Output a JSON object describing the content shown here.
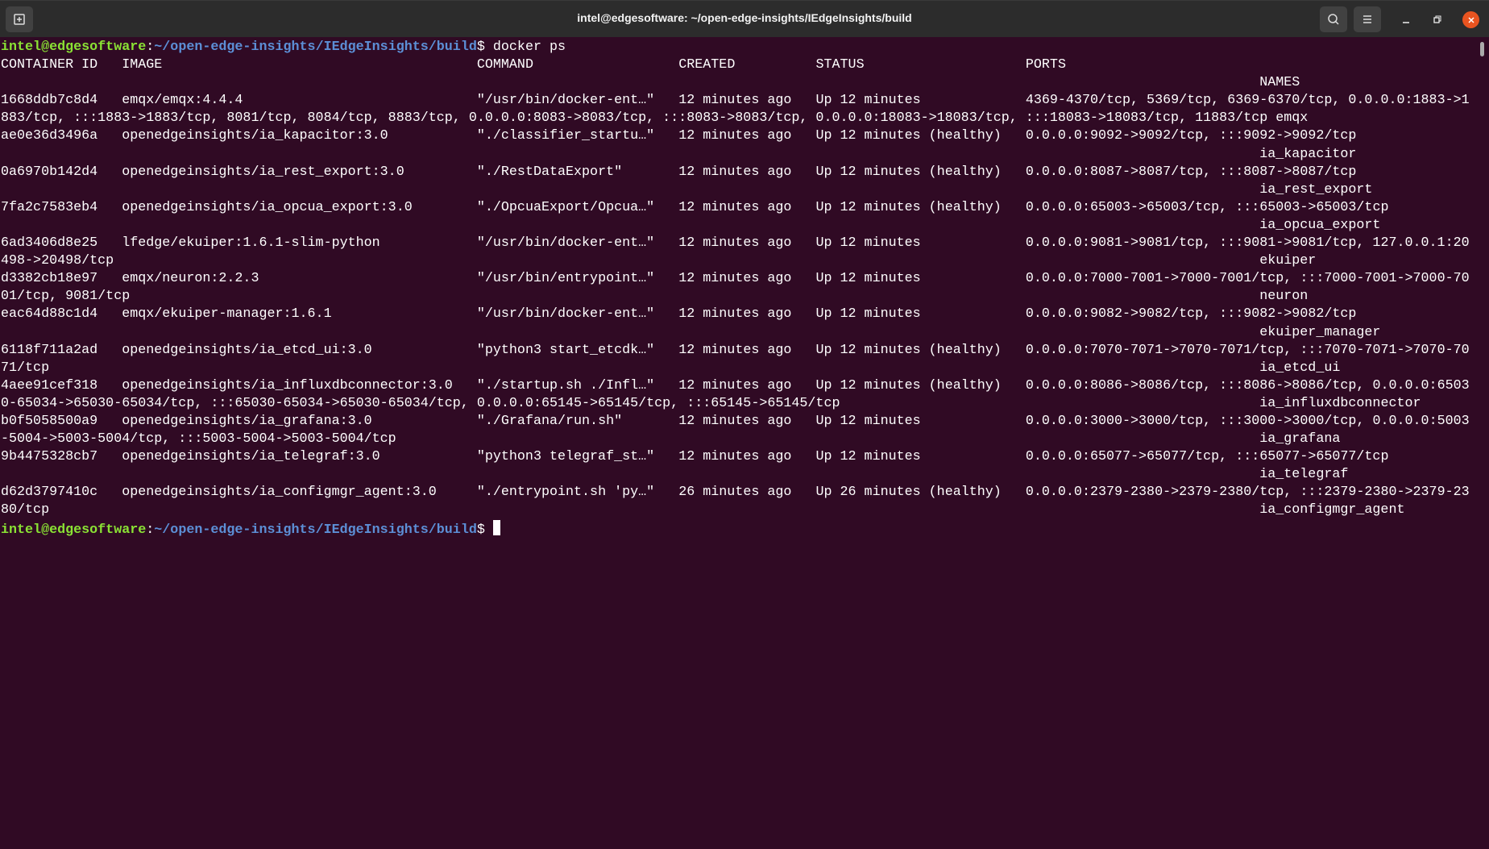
{
  "window": {
    "title": "intel@edgesoftware: ~/open-edge-insights/IEdgeInsights/build",
    "icons": [
      "new-tab-icon",
      "search-icon",
      "hamburger-menu-icon",
      "minimize-icon",
      "maximize-icon",
      "close-icon"
    ]
  },
  "colors": {
    "background": "#300a24",
    "prompt_user": "#8ae234",
    "prompt_path": "#5c8fd6",
    "close": "#e95420"
  },
  "prompt": {
    "user_host": "intel@edgesoftware",
    "sep": ":",
    "path": "~/open-edge-insights/IEdgeInsights/build",
    "symbol": "$ "
  },
  "command": "docker ps",
  "table": {
    "headers": [
      "CONTAINER ID",
      "IMAGE",
      "COMMAND",
      "CREATED",
      "STATUS",
      "PORTS",
      "NAMES"
    ],
    "rows": [
      [
        "1668ddb7c8d4",
        "emqx/emqx:4.4.4",
        "\"/usr/bin/docker-ent…\"",
        "12 minutes ago",
        "Up 12 minutes",
        "4369-4370/tcp, 5369/tcp, 6369-6370/tcp, 0.0.0.0:1883->1883/tcp, :::1883->1883/tcp, 8081/tcp, 8084/tcp, 8883/tcp, 0.0.0.0:8083->8083/tcp, :::8083->8083/tcp, 0.0.0.0:18083->18083/tcp, :::18083->18083/tcp, 11883/tcp",
        "emqx"
      ],
      [
        "ae0e36d3496a",
        "openedgeinsights/ia_kapacitor:3.0",
        "\"./classifier_startu…\"",
        "12 minutes ago",
        "Up 12 minutes (healthy)",
        "0.0.0.0:9092->9092/tcp, :::9092->9092/tcp",
        "ia_kapacitor"
      ],
      [
        "0a6970b142d4",
        "openedgeinsights/ia_rest_export:3.0",
        "\"./RestDataExport\"",
        "12 minutes ago",
        "Up 12 minutes (healthy)",
        "0.0.0.0:8087->8087/tcp, :::8087->8087/tcp",
        "ia_rest_export"
      ],
      [
        "7fa2c7583eb4",
        "openedgeinsights/ia_opcua_export:3.0",
        "\"./OpcuaExport/Opcua…\"",
        "12 minutes ago",
        "Up 12 minutes (healthy)",
        "0.0.0.0:65003->65003/tcp, :::65003->65003/tcp",
        "ia_opcua_export"
      ],
      [
        "6ad3406d8e25",
        "lfedge/ekuiper:1.6.1-slim-python",
        "\"/usr/bin/docker-ent…\"",
        "12 minutes ago",
        "Up 12 minutes",
        "0.0.0.0:9081->9081/tcp, :::9081->9081/tcp, 127.0.0.1:20498->20498/tcp",
        "ekuiper"
      ],
      [
        "d3382cb18e97",
        "emqx/neuron:2.2.3",
        "\"/usr/bin/entrypoint…\"",
        "12 minutes ago",
        "Up 12 minutes",
        "0.0.0.0:7000-7001->7000-7001/tcp, :::7000-7001->7000-7001/tcp, 9081/tcp",
        "neuron"
      ],
      [
        "eac64d88c1d4",
        "emqx/ekuiper-manager:1.6.1",
        "\"/usr/bin/docker-ent…\"",
        "12 minutes ago",
        "Up 12 minutes",
        "0.0.0.0:9082->9082/tcp, :::9082->9082/tcp",
        "ekuiper_manager"
      ],
      [
        "6118f711a2ad",
        "openedgeinsights/ia_etcd_ui:3.0",
        "\"python3 start_etcdk…\"",
        "12 minutes ago",
        "Up 12 minutes (healthy)",
        "0.0.0.0:7070-7071->7070-7071/tcp, :::7070-7071->7070-7071/tcp",
        "ia_etcd_ui"
      ],
      [
        "4aee91cef318",
        "openedgeinsights/ia_influxdbconnector:3.0",
        "\"./startup.sh ./Infl…\"",
        "12 minutes ago",
        "Up 12 minutes (healthy)",
        "0.0.0.0:8086->8086/tcp, :::8086->8086/tcp, 0.0.0.0:65030-65034->65030-65034/tcp, :::65030-65034->65030-65034/tcp, 0.0.0.0:65145->65145/tcp, :::65145->65145/tcp",
        "ia_influxdbconnector"
      ],
      [
        "b0f5058500a9",
        "openedgeinsights/ia_grafana:3.0",
        "\"./Grafana/run.sh\"",
        "12 minutes ago",
        "Up 12 minutes",
        "0.0.0.0:3000->3000/tcp, :::3000->3000/tcp, 0.0.0.0:5003-5004->5003-5004/tcp, :::5003-5004->5003-5004/tcp",
        "ia_grafana"
      ],
      [
        "9b4475328cb7",
        "openedgeinsights/ia_telegraf:3.0",
        "\"python3 telegraf_st…\"",
        "12 minutes ago",
        "Up 12 minutes",
        "0.0.0.0:65077->65077/tcp, :::65077->65077/tcp",
        "ia_telegraf"
      ],
      [
        "d62d3797410c",
        "openedgeinsights/ia_configmgr_agent:3.0",
        "\"./entrypoint.sh 'py…\"",
        "26 minutes ago",
        "Up 26 minutes (healthy)",
        "0.0.0.0:2379-2380->2379-2380/tcp, :::2379-2380->2379-2380/tcp",
        "ia_configmgr_agent"
      ]
    ]
  }
}
